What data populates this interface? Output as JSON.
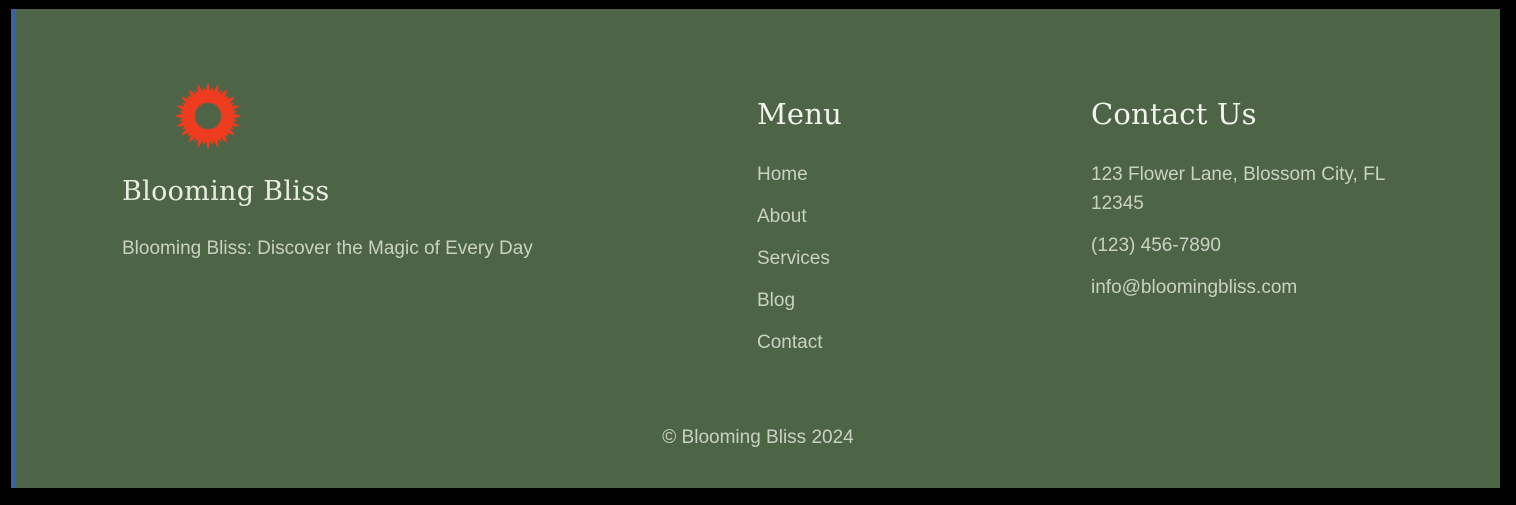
{
  "theme": {
    "page_background": "#4d6446",
    "letterbox": "#000000",
    "rail_accent": "#3a62a4",
    "logo_color": "#f03c1e",
    "heading_color": "#f2f4ee",
    "body_text_color": "#c9d2c2"
  },
  "brand": {
    "logo_icon": "flower-sunburst-icon",
    "name": "Blooming Bliss",
    "tagline": "Blooming Bliss: Discover the Magic of Every Day"
  },
  "menu": {
    "title": "Menu",
    "items": [
      {
        "label": "Home"
      },
      {
        "label": "About"
      },
      {
        "label": "Services"
      },
      {
        "label": "Blog"
      },
      {
        "label": "Contact"
      }
    ]
  },
  "contact": {
    "title": "Contact Us",
    "lines": [
      {
        "text": "123 Flower Lane, Blossom City, FL 12345"
      },
      {
        "text": "(123) 456-7890"
      },
      {
        "text": "info@bloomingbliss.com"
      }
    ]
  },
  "copyright": {
    "text": "© Blooming Bliss 2024"
  }
}
